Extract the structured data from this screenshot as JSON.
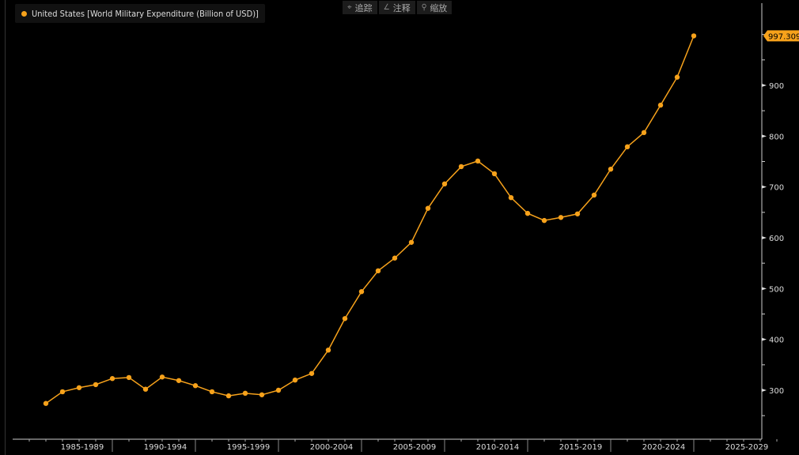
{
  "legend": {
    "label": "United States [World Military Expenditure (Billion of USD)]"
  },
  "toolbar": [
    {
      "icon": "crosshair-icon",
      "glyph": "⌖",
      "label": "追踪"
    },
    {
      "icon": "annotate-icon",
      "glyph": "∠",
      "label": "注释"
    },
    {
      "icon": "zoom-icon",
      "glyph": "⚲",
      "label": "缩放"
    }
  ],
  "chart_data": {
    "type": "line",
    "title": "United States [World Military Expenditure (Billion of USD)]",
    "color": "#f7a21b",
    "x": [
      1985,
      1986,
      1987,
      1988,
      1989,
      1990,
      1991,
      1992,
      1993,
      1994,
      1995,
      1996,
      1997,
      1998,
      1999,
      2000,
      2001,
      2002,
      2003,
      2004,
      2005,
      2006,
      2007,
      2008,
      2009,
      2010,
      2011,
      2012,
      2013,
      2014,
      2015,
      2016,
      2017,
      2018,
      2019,
      2020,
      2021,
      2022,
      2023,
      2024
    ],
    "values": [
      274,
      297,
      305,
      311,
      323,
      325,
      302,
      326,
      319,
      309,
      297,
      289,
      294,
      291,
      300,
      320,
      333,
      379,
      441,
      494,
      535,
      560,
      591,
      658,
      706,
      740,
      751,
      726,
      679,
      648,
      634,
      640,
      647,
      684,
      735,
      779,
      807,
      861,
      916,
      997.309
    ],
    "last_value_label": "997.309",
    "y_ticks": [
      "300",
      "400",
      "500",
      "600",
      "700",
      "800",
      "900"
    ],
    "y_tick_values": [
      300,
      400,
      500,
      600,
      700,
      800,
      900
    ],
    "ylim": [
      210,
      1050
    ],
    "x_tick_labels": [
      "1985-1989",
      "1990-1994",
      "1995-1999",
      "2000-2004",
      "2005-2009",
      "2010-2014",
      "2015-2019",
      "2020-2024",
      "2025-2029"
    ],
    "xlim": [
      1983,
      2029.5
    ],
    "legend_position": "top-left",
    "grid": false
  }
}
